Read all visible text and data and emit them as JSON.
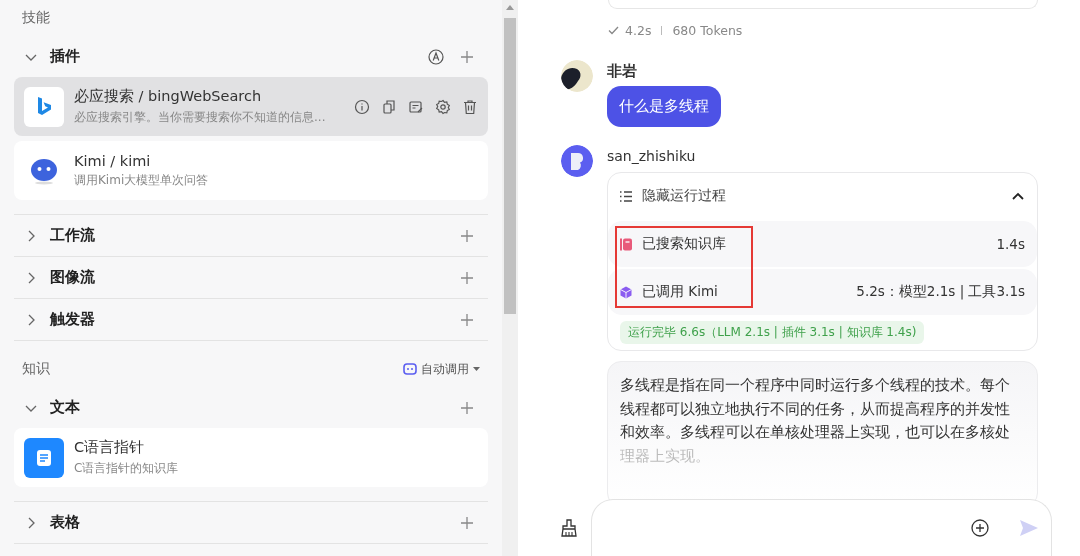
{
  "skills": {
    "title": "技能",
    "sections": [
      {
        "label": "插件",
        "expanded": true,
        "auto_icon": true,
        "items": [
          {
            "kind": "bing",
            "title": "必应搜索 / bingWebSearch",
            "description": "必应搜索引擎。当你需要搜索你不知道的信息...",
            "selected": true
          },
          {
            "kind": "kimi",
            "title": "Kimi / kimi",
            "description": "调用Kimi大模型单次问答",
            "selected": false
          }
        ]
      },
      {
        "label": "工作流",
        "expanded": false
      },
      {
        "label": "图像流",
        "expanded": false
      },
      {
        "label": "触发器",
        "expanded": false
      }
    ]
  },
  "knowledge": {
    "title": "知识",
    "mode": "自动调用",
    "sections": [
      {
        "label": "文本",
        "expanded": true,
        "items": [
          {
            "kind": "doc",
            "title": "C语言指针",
            "description": "C语言指针的知识库",
            "selected": false
          }
        ]
      },
      {
        "label": "表格",
        "expanded": false
      }
    ]
  },
  "chat": {
    "previous_meta": {
      "time": "4.2s",
      "tokens": "680 Tokens"
    },
    "messages": [
      {
        "kind": "user",
        "name": "非岩",
        "text": "什么是多线程"
      },
      {
        "kind": "bot",
        "name": "san_zhishiku",
        "process": {
          "toggle": "隐藏运行过程",
          "expanded": true,
          "steps": [
            {
              "kind": "knowledge",
              "label": "已搜索知识库",
              "time": "1.4s"
            },
            {
              "kind": "plugin",
              "label": "已调用 Kimi",
              "time": "5.2s：模型2.1s | 工具3.1s"
            }
          ],
          "summary": "运行完毕 6.6s（LLM 2.1s | 插件 3.1s | 知识库 1.4s)"
        },
        "answer": "多线程是指在同一个程序中同时运行多个线程的技术。每个线程都可以独立地执行不同的任务，从而提高程序的并发性和效率。多线程可以在单核处理器上实现，也可以在多核处",
        "answer_faded": "理器上实现。"
      }
    ]
  }
}
